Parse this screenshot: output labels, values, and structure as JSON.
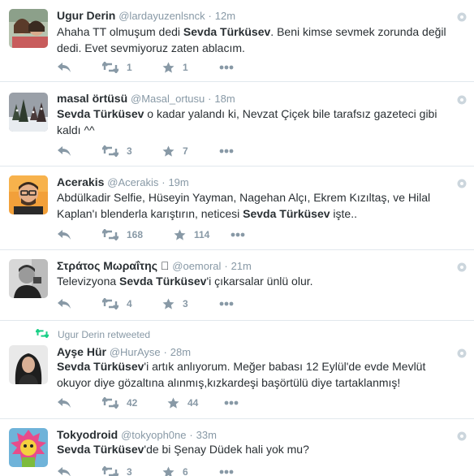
{
  "tweets": [
    {
      "name": "Ugur Derin",
      "handle": "@lardayuzenlsnck",
      "time": "12m",
      "text_parts": [
        "Ahaha TT olmuşum dedi ",
        "Sevda Türküsev",
        ". Beni kimse sevmek zorunda değil dedi. Evet sevmiyoruz zaten ablacım."
      ],
      "retweets": "1",
      "favorites": "1"
    },
    {
      "name": "masal örtüsü",
      "handle": "@Masal_ortusu",
      "time": "18m",
      "text_parts": [
        "",
        "Sevda Türküsev",
        " o kadar yalandı ki, Nevzat Çiçek bile tarafsız gazeteci gibi kaldı ^^"
      ],
      "retweets": "3",
      "favorites": "7"
    },
    {
      "name": "Acerakis",
      "handle": "@Acerakis",
      "time": "19m",
      "text_parts": [
        "Abdülkadir Selfie, Hüseyin Yayman, Nagehan Alçı, Ekrem Kızıltaş, ve Hilal Kaplan'ı blenderla karıştırın, neticesi ",
        "Sevda Türküsev",
        " işte.."
      ],
      "retweets": "168",
      "favorites": "114"
    },
    {
      "name": "Στράτος Μωραΐτης 󾓬",
      "handle": "@oemoral",
      "time": "21m",
      "text_parts": [
        "Televizyona ",
        "Sevda Türküsev",
        "'i çıkarsalar ünlü olur."
      ],
      "retweets": "4",
      "favorites": "3"
    },
    {
      "retweeted_by": "Ugur Derin retweeted",
      "name": "Ayşe Hür",
      "handle": "@HurAyse",
      "time": "28m",
      "text_parts": [
        "",
        "Sevda Türküsev",
        "'i artık anlıyorum. Meğer babası 12 Eylül'de evde Mevlüt okuyor diye gözaltına alınmış,kızkardeşi başörtülü diye tartaklanmış!"
      ],
      "retweets": "42",
      "favorites": "44"
    },
    {
      "name": "Tokyodroid",
      "handle": "@tokyoph0ne",
      "time": "33m",
      "text_parts": [
        "",
        "Sevda Türküsev",
        "'de bi Şenay Düdek hali yok mu?"
      ],
      "retweets": "3",
      "favorites": "6"
    }
  ],
  "separator": "·",
  "colors": {
    "text": "#292f33",
    "muted": "#8899a6",
    "border": "#e1e8ed",
    "retweet_green": "#19cf86"
  },
  "icons": [
    "reply-icon",
    "retweet-icon",
    "favorite-icon",
    "more-icon",
    "gear-icon",
    "retweeted-icon"
  ]
}
